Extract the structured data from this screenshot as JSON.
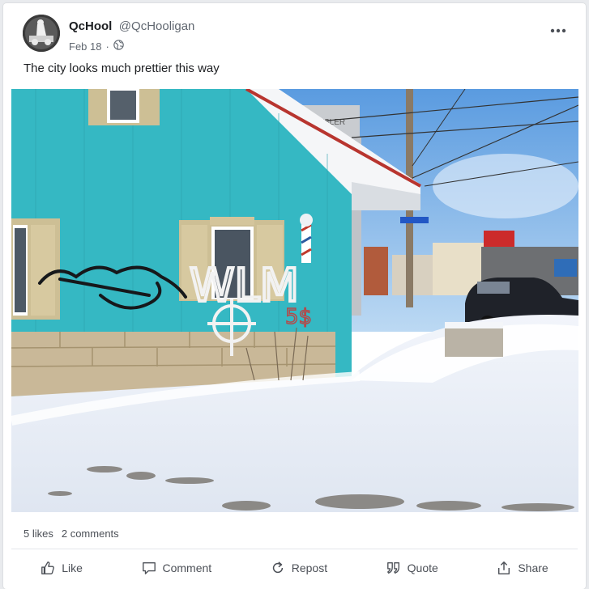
{
  "post": {
    "author": {
      "display_name": "QcHool",
      "handle": "@QcHooligan"
    },
    "date": "Feb 18",
    "meta_separator": "·",
    "text": "The city looks much prettier this way",
    "image_alt": "Snowy street corner with a turquoise wooden building covered in graffiti"
  },
  "photo": {
    "graffiti_tag": "WLM",
    "graffiti_sub": "5$",
    "sign_text": "CHRYSLER"
  },
  "stats": {
    "likes": "5 likes",
    "comments": "2 comments"
  },
  "actions": {
    "like": "Like",
    "comment": "Comment",
    "repost": "Repost",
    "quote": "Quote",
    "share": "Share"
  },
  "icons": [
    "avatar",
    "globe-icon",
    "more-icon",
    "like-icon",
    "comment-icon",
    "repost-icon",
    "quote-icon",
    "share-icon"
  ]
}
